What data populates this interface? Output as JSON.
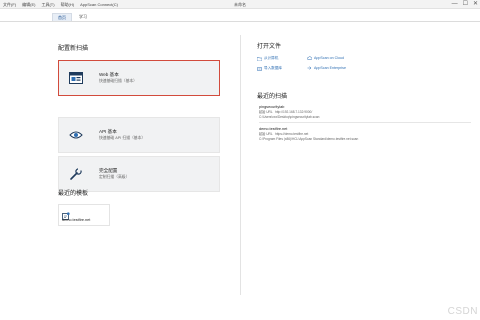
{
  "menu": [
    "文件(F)",
    "编辑(E)",
    "工具(T)",
    "帮助(H)",
    "AppScan Connect(C)"
  ],
  "app_title": "未命名",
  "window_controls": [
    "—",
    "☐",
    "✕"
  ],
  "tabs": [
    {
      "label": "首页",
      "active": true
    },
    {
      "label": "学习",
      "active": false
    }
  ],
  "left": {
    "configure_title": "配置新扫描",
    "cards": [
      {
        "title": "Web 基本",
        "subtitle": "快速基础扫描（基本）",
        "icon": "web-window-icon",
        "selected": true
      },
      {
        "title": "API 基本",
        "subtitle": "快速基础 API 扫描（基本）",
        "icon": "api-eye-icon",
        "selected": false
      },
      {
        "title": "完全配置",
        "subtitle": "定制扫描（高级）",
        "icon": "wrench-icon",
        "selected": false
      }
    ],
    "templates_title": "最近的模板",
    "templates": [
      {
        "name": "demo.testfire.net",
        "icon": "template-icon"
      }
    ]
  },
  "right": {
    "open_file_title": "打开文件",
    "links": [
      {
        "label": "从计算机",
        "icon": "folder-icon"
      },
      {
        "label": "AppScan on Cloud",
        "icon": "cloud-icon"
      },
      {
        "label": "导入数据库",
        "icon": "database-import-icon"
      },
      {
        "label": "AppScan Enterprise",
        "icon": "enterprise-icon"
      }
    ],
    "recent_scans_title": "最近的扫描",
    "recent_scans": [
      {
        "name": "pingsecuritylab",
        "url_label": "起始 URL",
        "url": "http://192.168.7.132:9000/",
        "path": "C:\\Users\\xxx\\Desktop\\pingsecuritylab.scan"
      },
      {
        "name": "demo.testfire.net",
        "url_label": "起始 URL",
        "url": "https://demo.testfire.net",
        "path": "C:\\Program Files (x86)\\HCL\\AppScan Standard\\demo.testfire.net.scan"
      }
    ]
  },
  "watermark": "CSDN",
  "colors": {
    "accent": "#2f6fb3",
    "selection_border": "#d24b3c",
    "card_bg": "#f1f2f3"
  }
}
